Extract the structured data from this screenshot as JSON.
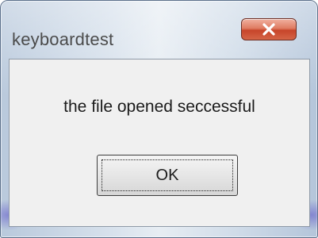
{
  "window": {
    "title": "keyboardtest",
    "close_icon": "close-icon"
  },
  "dialog": {
    "message": "the file opened seccessful",
    "ok_label": "OK"
  },
  "colors": {
    "close_button": "#d4583c",
    "client_background": "#f0f0f0",
    "frame": "#c6d4e3"
  }
}
